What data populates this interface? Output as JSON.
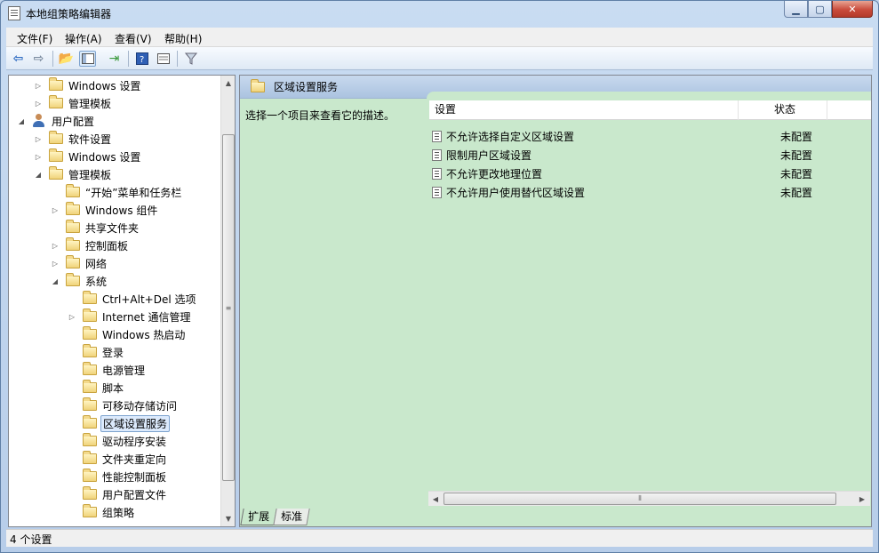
{
  "window": {
    "title": "本地组策略编辑器",
    "min_label": "▁",
    "max_label": "▢",
    "close_label": "✕"
  },
  "menu": [
    "文件(F)",
    "操作(A)",
    "查看(V)",
    "帮助(H)"
  ],
  "toolbar_icons": [
    "back-icon",
    "forward-icon",
    "up-folder-icon",
    "show-hide-tree-icon",
    "export-list-icon",
    "help-icon",
    "properties-view-icon",
    "filter-icon"
  ],
  "tree": [
    {
      "label": "Windows 设置",
      "level": 1,
      "expander": "collapsed"
    },
    {
      "label": "管理模板",
      "level": 1,
      "expander": "collapsed"
    },
    {
      "label": "用户配置",
      "level": 0,
      "expander": "expanded",
      "icon": "user"
    },
    {
      "label": "软件设置",
      "level": 1,
      "expander": "collapsed"
    },
    {
      "label": "Windows 设置",
      "level": 1,
      "expander": "collapsed"
    },
    {
      "label": "管理模板",
      "level": 1,
      "expander": "expanded"
    },
    {
      "label": "“开始”菜单和任务栏",
      "level": 2,
      "expander": "none"
    },
    {
      "label": "Windows 组件",
      "level": 2,
      "expander": "collapsed"
    },
    {
      "label": "共享文件夹",
      "level": 2,
      "expander": "none"
    },
    {
      "label": "控制面板",
      "level": 2,
      "expander": "collapsed"
    },
    {
      "label": "网络",
      "level": 2,
      "expander": "collapsed"
    },
    {
      "label": "系统",
      "level": 2,
      "expander": "expanded"
    },
    {
      "label": "Ctrl+Alt+Del 选项",
      "level": 3,
      "expander": "none"
    },
    {
      "label": "Internet 通信管理",
      "level": 3,
      "expander": "collapsed"
    },
    {
      "label": "Windows 热启动",
      "level": 3,
      "expander": "none"
    },
    {
      "label": "登录",
      "level": 3,
      "expander": "none"
    },
    {
      "label": "电源管理",
      "level": 3,
      "expander": "none"
    },
    {
      "label": "脚本",
      "level": 3,
      "expander": "none"
    },
    {
      "label": "可移动存储访问",
      "level": 3,
      "expander": "none"
    },
    {
      "label": "区域设置服务",
      "level": 3,
      "expander": "none",
      "selected": true
    },
    {
      "label": "驱动程序安装",
      "level": 3,
      "expander": "none"
    },
    {
      "label": "文件夹重定向",
      "level": 3,
      "expander": "none"
    },
    {
      "label": "性能控制面板",
      "level": 3,
      "expander": "none"
    },
    {
      "label": "用户配置文件",
      "level": 3,
      "expander": "none"
    },
    {
      "label": "组策略",
      "level": 3,
      "expander": "none"
    }
  ],
  "right": {
    "header_title": "区域设置服务",
    "description": "选择一个项目来查看它的描述。",
    "columns": [
      "设置",
      "状态"
    ],
    "rows": [
      {
        "name": "不允许选择自定义区域设置",
        "state": "未配置"
      },
      {
        "name": "限制用户区域设置",
        "state": "未配置"
      },
      {
        "name": "不允许更改地理位置",
        "state": "未配置"
      },
      {
        "name": "不允许用户使用替代区域设置",
        "state": "未配置"
      }
    ],
    "tabs": [
      "扩展",
      "标准"
    ],
    "active_tab": "扩展"
  },
  "status": "4 个设置",
  "colors": {
    "content_bg": "#c9e8cc",
    "header_bg": "#abc3e0",
    "selection": "#dceafc"
  }
}
